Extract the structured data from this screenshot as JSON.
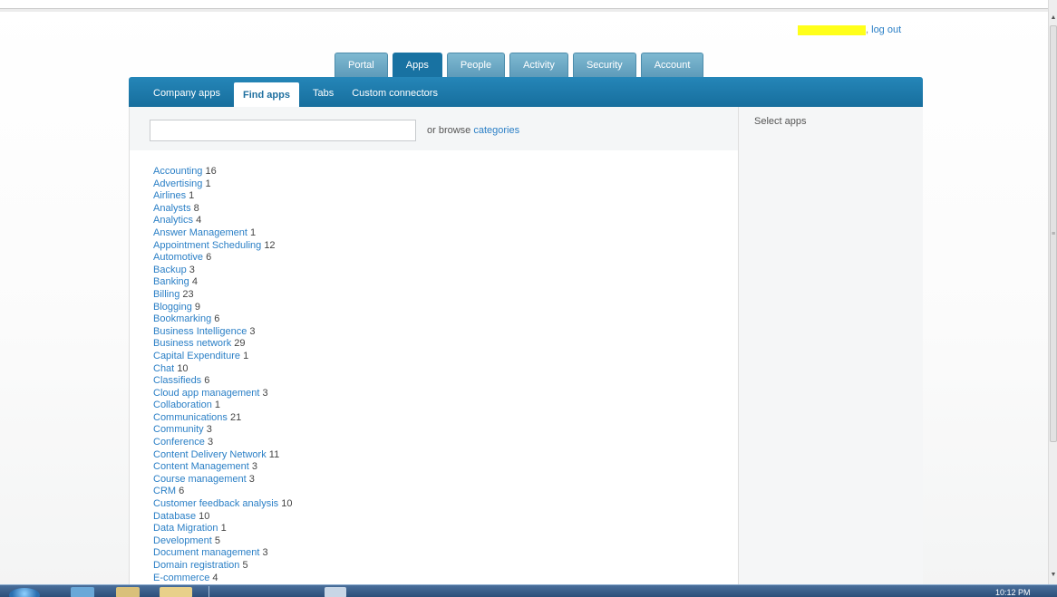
{
  "user": {
    "name": "",
    "separator": ",",
    "logout_label": "log out",
    "highlight_color": "#ffff1a"
  },
  "main_tabs": [
    {
      "label": "Portal",
      "active": false
    },
    {
      "label": "Apps",
      "active": true
    },
    {
      "label": "People",
      "active": false
    },
    {
      "label": "Activity",
      "active": false
    },
    {
      "label": "Security",
      "active": false
    },
    {
      "label": "Account",
      "active": false
    }
  ],
  "sub_tabs": [
    {
      "label": "Company apps",
      "active": false
    },
    {
      "label": "Find apps",
      "active": true
    },
    {
      "label": "Tabs",
      "active": false
    },
    {
      "label": "Custom connectors",
      "active": false
    }
  ],
  "search": {
    "value": "",
    "placeholder": "",
    "browse_prefix": "or browse",
    "browse_link": "categories"
  },
  "categories": [
    {
      "name": "Accounting",
      "count": "16"
    },
    {
      "name": "Advertising",
      "count": "1"
    },
    {
      "name": "Airlines",
      "count": "1"
    },
    {
      "name": "Analysts",
      "count": "8"
    },
    {
      "name": "Analytics",
      "count": "4"
    },
    {
      "name": "Answer Management",
      "count": "1"
    },
    {
      "name": "Appointment Scheduling",
      "count": "12"
    },
    {
      "name": "Automotive",
      "count": "6"
    },
    {
      "name": "Backup",
      "count": "3"
    },
    {
      "name": "Banking",
      "count": "4"
    },
    {
      "name": "Billing",
      "count": "23"
    },
    {
      "name": "Blogging",
      "count": "9"
    },
    {
      "name": "Bookmarking",
      "count": "6"
    },
    {
      "name": "Business Intelligence",
      "count": "3"
    },
    {
      "name": "Business network",
      "count": "29"
    },
    {
      "name": "Capital Expenditure",
      "count": "1"
    },
    {
      "name": "Chat",
      "count": "10"
    },
    {
      "name": "Classifieds",
      "count": "6"
    },
    {
      "name": "Cloud app management",
      "count": "3"
    },
    {
      "name": "Collaboration",
      "count": "1"
    },
    {
      "name": "Communications",
      "count": "21"
    },
    {
      "name": "Community",
      "count": "3"
    },
    {
      "name": "Conference",
      "count": "3"
    },
    {
      "name": "Content Delivery Network",
      "count": "11"
    },
    {
      "name": "Content Management",
      "count": "3"
    },
    {
      "name": "Course management",
      "count": "3"
    },
    {
      "name": "CRM",
      "count": "6"
    },
    {
      "name": "Customer feedback analysis",
      "count": "10"
    },
    {
      "name": "Database",
      "count": "10"
    },
    {
      "name": "Data Migration",
      "count": "1"
    },
    {
      "name": "Development",
      "count": "5"
    },
    {
      "name": "Document management",
      "count": "3"
    },
    {
      "name": "Domain registration",
      "count": "5"
    },
    {
      "name": "E-commerce",
      "count": "4"
    }
  ],
  "side_panel": {
    "title": "Select apps"
  },
  "taskbar": {
    "clock": "10:12 PM"
  },
  "colors": {
    "accent": "#1872a2",
    "link": "#2a7fc6",
    "tab": "#5d9bba"
  }
}
